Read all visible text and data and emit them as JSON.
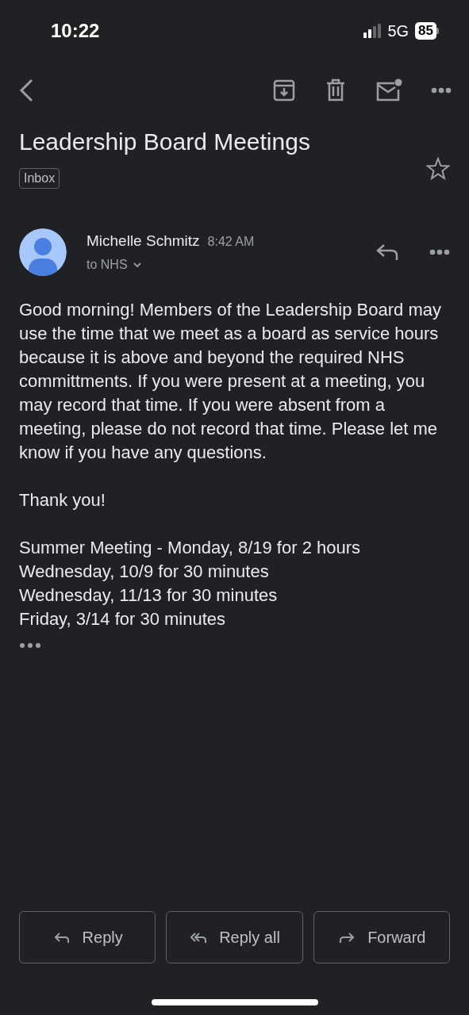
{
  "status_bar": {
    "time": "10:22",
    "network": "5G",
    "battery": "85"
  },
  "subject": "Leadership Board Meetings",
  "label": "Inbox",
  "starred": false,
  "message": {
    "sender": "Michelle Schmitz",
    "time": "8:42 AM",
    "recipients": "to NHS",
    "paragraphs": [
      "Good morning! Members of the Leadership Board may use the time that we meet as a board as service hours because it is above and beyond the required NHS committments. If you were present at a meeting, you may record that time. If you were absent from a meeting, please do not record that time. Please let me know if you have any questions.",
      "Thank you!"
    ],
    "lines": [
      "Summer Meeting - Monday, 8/19 for 2 hours",
      "Wednesday, 10/9 for 30 minutes",
      "Wednesday, 11/13 for 30 minutes",
      "Friday, 3/14 for 30 minutes"
    ]
  },
  "actions": [
    {
      "kind": "reply",
      "label": "Reply"
    },
    {
      "kind": "reply_all",
      "label": "Reply all"
    },
    {
      "kind": "forward",
      "label": "Forward"
    }
  ]
}
